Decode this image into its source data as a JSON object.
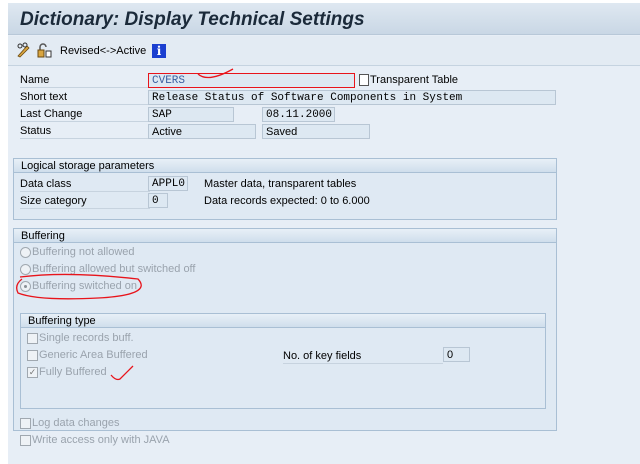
{
  "title": "Dictionary: Display Technical Settings",
  "toolbar": {
    "revised_active": "Revised<->Active"
  },
  "header": {
    "name_label": "Name",
    "name_value": "CVERS",
    "table_type": "Transparent Table",
    "short_text_label": "Short text",
    "short_text_value": "Release Status of Software Components in System",
    "last_change_label": "Last Change",
    "last_change_user": "SAP",
    "last_change_date": "08.11.2000",
    "status_label": "Status",
    "status_value": "Active",
    "status_saved": "Saved"
  },
  "logical_storage": {
    "title": "Logical storage parameters",
    "data_class_label": "Data class",
    "data_class_value": "APPL0",
    "data_class_desc": "Master data, transparent tables",
    "size_label": "Size category",
    "size_value": "0",
    "size_desc": "Data records expected: 0 to 6.000"
  },
  "buffering": {
    "title": "Buffering",
    "options": [
      "Buffering not allowed",
      "Buffering allowed but switched off",
      "Buffering switched on"
    ],
    "selected": 2,
    "type": {
      "title": "Buffering type",
      "options": [
        "Single records buff.",
        "Generic Area Buffered",
        "Fully Buffered"
      ],
      "checked": [
        false,
        false,
        true
      ],
      "key_fields_label": "No. of key fields",
      "key_fields_value": "0"
    }
  },
  "options": [
    "Log data changes",
    "Write access only with JAVA"
  ],
  "colors": {
    "annotation": "#e8141b",
    "bg": "#e7eef6"
  }
}
